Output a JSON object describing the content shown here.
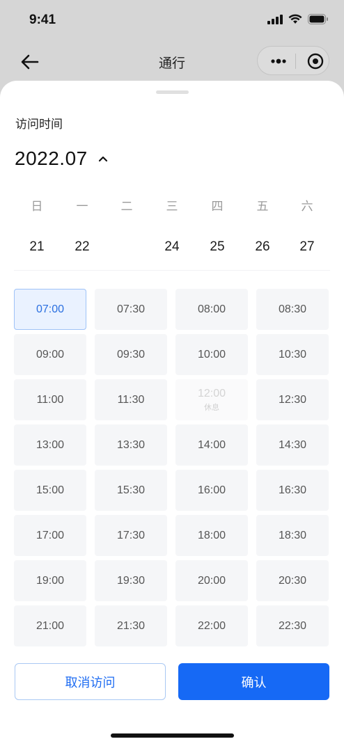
{
  "status_bar": {
    "time": "9:41",
    "icons": [
      "signal-icon",
      "wifi-icon",
      "battery-icon"
    ]
  },
  "nav": {
    "title": "通行",
    "icons": [
      "back-arrow-icon",
      "more-icon",
      "target-icon"
    ]
  },
  "sheet": {
    "section_label": "访问时间",
    "month": "2022.07",
    "weekdays": [
      "日",
      "一",
      "二",
      "三",
      "四",
      "五",
      "六"
    ],
    "dates": [
      "21",
      "22",
      "",
      "24",
      "25",
      "26",
      "27"
    ],
    "slots": [
      {
        "time": "07:00",
        "state": "selected",
        "note": ""
      },
      {
        "time": "07:30",
        "state": "normal",
        "note": ""
      },
      {
        "time": "08:00",
        "state": "normal",
        "note": ""
      },
      {
        "time": "08:30",
        "state": "normal",
        "note": ""
      },
      {
        "time": "09:00",
        "state": "normal",
        "note": ""
      },
      {
        "time": "09:30",
        "state": "normal",
        "note": ""
      },
      {
        "time": "10:00",
        "state": "normal",
        "note": ""
      },
      {
        "time": "10:30",
        "state": "normal",
        "note": ""
      },
      {
        "time": "11:00",
        "state": "normal",
        "note": ""
      },
      {
        "time": "11:30",
        "state": "normal",
        "note": ""
      },
      {
        "time": "12:00",
        "state": "disabled",
        "note": "休息"
      },
      {
        "time": "12:30",
        "state": "normal",
        "note": ""
      },
      {
        "time": "13:00",
        "state": "normal",
        "note": ""
      },
      {
        "time": "13:30",
        "state": "normal",
        "note": ""
      },
      {
        "time": "14:00",
        "state": "normal",
        "note": ""
      },
      {
        "time": "14:30",
        "state": "normal",
        "note": ""
      },
      {
        "time": "15:00",
        "state": "normal",
        "note": ""
      },
      {
        "time": "15:30",
        "state": "normal",
        "note": ""
      },
      {
        "time": "16:00",
        "state": "normal",
        "note": ""
      },
      {
        "time": "16:30",
        "state": "normal",
        "note": ""
      },
      {
        "time": "17:00",
        "state": "normal",
        "note": ""
      },
      {
        "time": "17:30",
        "state": "normal",
        "note": ""
      },
      {
        "time": "18:00",
        "state": "normal",
        "note": ""
      },
      {
        "time": "18:30",
        "state": "normal",
        "note": ""
      },
      {
        "time": "19:00",
        "state": "normal",
        "note": ""
      },
      {
        "time": "19:30",
        "state": "normal",
        "note": ""
      },
      {
        "time": "20:00",
        "state": "normal",
        "note": ""
      },
      {
        "time": "20:30",
        "state": "normal",
        "note": ""
      },
      {
        "time": "21:00",
        "state": "normal",
        "note": ""
      },
      {
        "time": "21:30",
        "state": "normal",
        "note": ""
      },
      {
        "time": "22:00",
        "state": "normal",
        "note": ""
      },
      {
        "time": "22:30",
        "state": "normal",
        "note": ""
      }
    ],
    "cancel_label": "取消访问",
    "confirm_label": "确认"
  },
  "colors": {
    "accent": "#1669f5",
    "selected_bg": "#eaf2ff",
    "slot_bg": "#f5f6f8"
  }
}
